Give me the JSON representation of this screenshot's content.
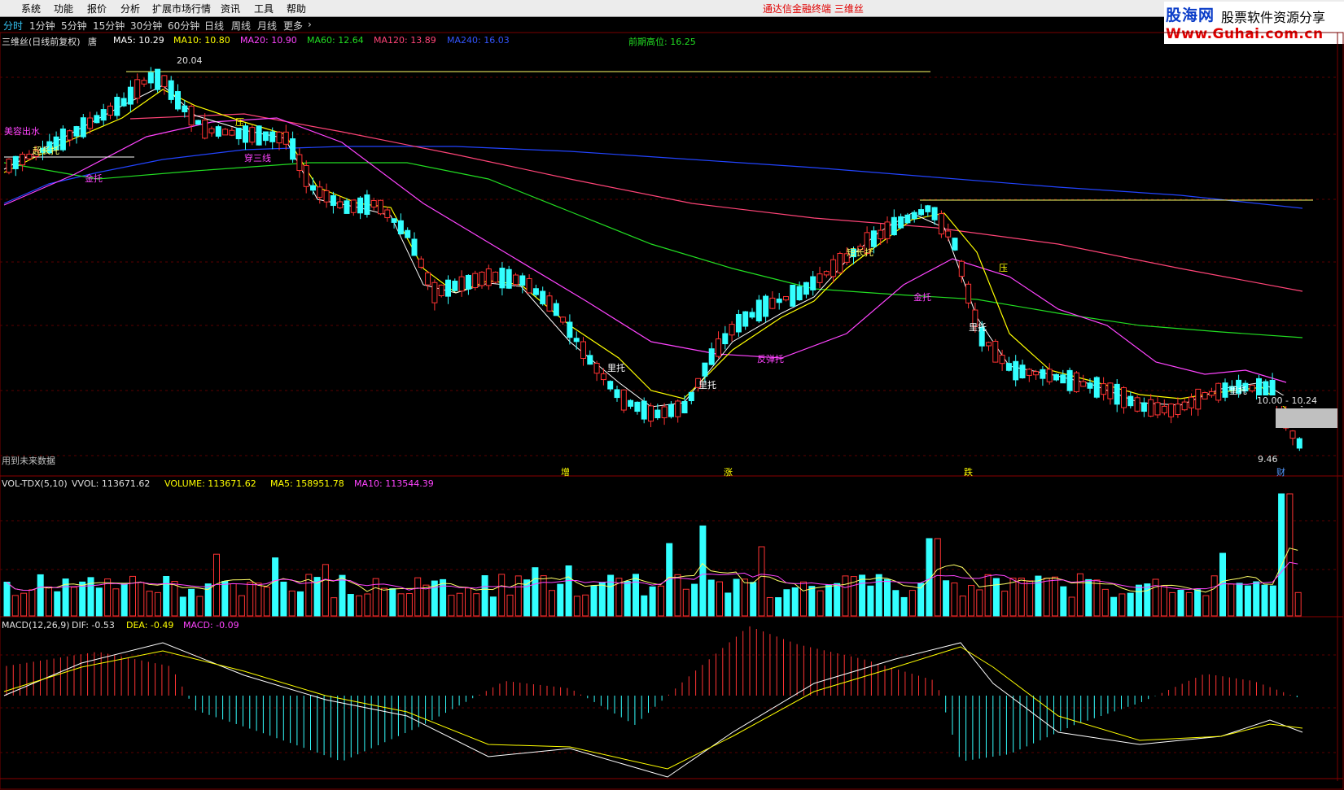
{
  "menubar": {
    "items": [
      "系统",
      "功能",
      "报价",
      "分析",
      "扩展市场行情",
      "资讯",
      "工具",
      "帮助"
    ],
    "window_title": "通达信金融终端   三维丝"
  },
  "logo": {
    "brand": "股海网",
    "slogan": "股票软件资源分享",
    "url": "Www.Guhai.com.cn"
  },
  "periods": {
    "items": [
      "分时",
      "1分钟",
      "5分钟",
      "15分钟",
      "30分钟",
      "60分钟",
      "日线",
      "周线",
      "月线",
      "更多"
    ],
    "active": "分时"
  },
  "main_panel": {
    "stock_label": "三维丝(日线前复权)",
    "stock_suffix": "唐",
    "ma_labels": [
      {
        "text": "MA5: 10.29",
        "color": "#ffffff"
      },
      {
        "text": "MA10: 10.80",
        "color": "#ffff00"
      },
      {
        "text": "MA20: 10.90",
        "color": "#ff44ff"
      },
      {
        "text": "MA60: 12.64",
        "color": "#22dd22"
      },
      {
        "text": "MA120: 13.89",
        "color": "#ff4477"
      },
      {
        "text": "MA240: 16.03",
        "color": "#2244ff"
      }
    ],
    "prev_high_label": "前期高位: 16.25",
    "high_price": "20.04",
    "low_price": "9.46",
    "price_range_label": "10.00 - 10.24",
    "footer_note": "用到未来数据",
    "annotations": [
      "美容出水",
      "超长托",
      "金托",
      "穿三线",
      "里托",
      "金托",
      "短长托",
      "里托",
      "里托",
      "里托",
      "反弹托",
      "里托",
      "压",
      "压"
    ],
    "event_marks": [
      "增",
      "涨",
      "跌",
      "财"
    ]
  },
  "volume_panel": {
    "title": "VOL-TDX(5,10)",
    "vvol": "VVOL: 113671.62",
    "volume": "VOLUME: 113671.62",
    "ma5": "MA5: 158951.78",
    "ma10": "MA10: 113544.39"
  },
  "macd_panel": {
    "title": "MACD(12,26,9)",
    "dif": "DIF: -0.53",
    "dea": "DEA: -0.49",
    "macd": "MACD: -0.09"
  },
  "colors": {
    "up": "#ff3333",
    "down": "#33ffff",
    "bg": "#000000",
    "divider": "#7a0000",
    "ma5": "#ffffff",
    "ma10": "#ffff00",
    "ma20": "#ff44ff",
    "ma60": "#22dd22",
    "ma120": "#ff4477",
    "ma240": "#2244ff",
    "fill_down": "#5a8a3a",
    "fill_up": "#aa3030"
  }
}
